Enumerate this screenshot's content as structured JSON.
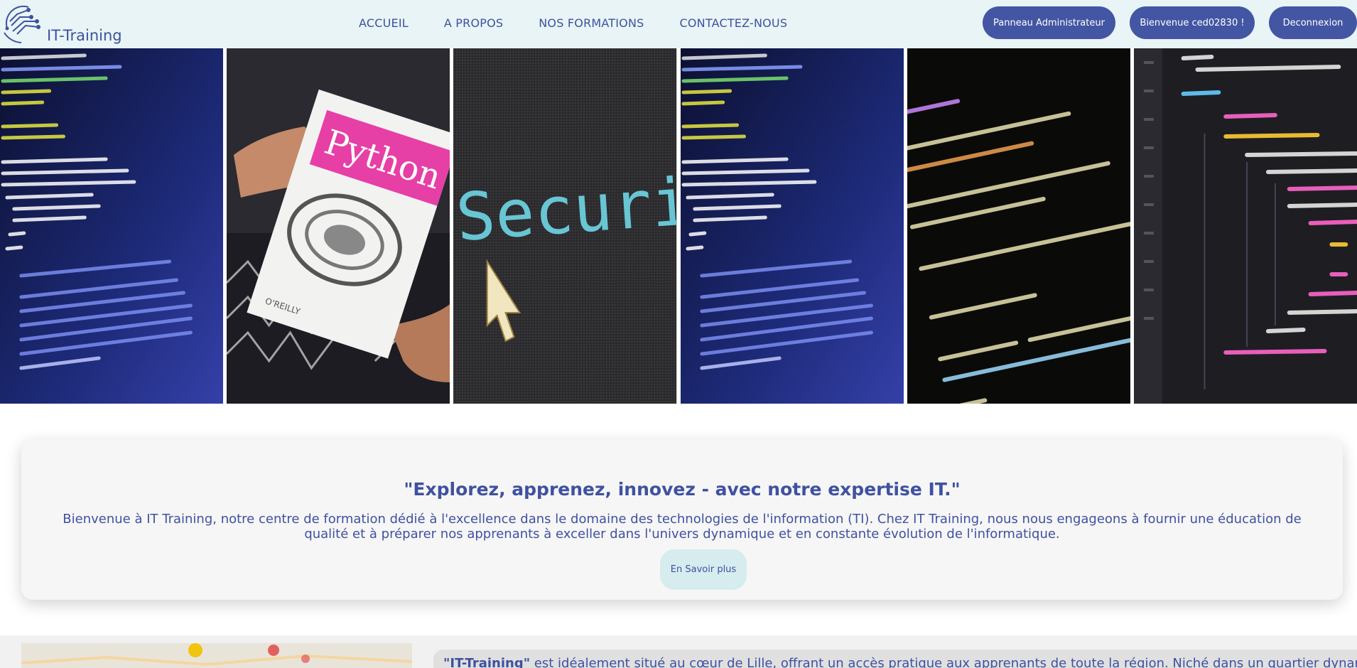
{
  "brand": {
    "name": "IT-Training"
  },
  "nav": {
    "links": [
      "ACCUEIL",
      "A PROPOS",
      "NOS FORMATIONS",
      "CONTACTEZ-NOUS"
    ]
  },
  "actions": {
    "admin_label": "Panneau Administrateur",
    "welcome_label": "Bienvenue ced02830 !",
    "logout_label": "Deconnexion"
  },
  "hero": {
    "slogan": "\"Explorez, apprenez, innovez - avec notre expertise IT.\"",
    "text": "Bienvenue à IT Training, notre centre de formation dédié à l'excellence dans le domaine des technologies de l'information (TI). Chez IT Training, nous nous engageons à fournir une éducation de qualité et à préparer nos apprenants à exceller dans l'univers dynamique et en constante évolution de l'informatique.",
    "button_label": "En Savoir plus"
  },
  "about": {
    "brand_quote": "\"IT-Training\"",
    "text": " est idéalement situé au cœur de Lille, offrant un accès pratique aux apprenants de toute la région. Niché dans un quartier dynamique et"
  },
  "colors": {
    "accent": "#3f51a0",
    "button": "#4356a3",
    "navbar_bg": "#e8f4f6",
    "hero_bg": "#f6f6f6",
    "hero_button_bg": "#d6ecef"
  },
  "tiles": [
    {
      "icon": "code-screen-image"
    },
    {
      "icon": "python-book-image"
    },
    {
      "icon": "security-screen-image"
    },
    {
      "icon": "code-screen-image"
    },
    {
      "icon": "php-code-image"
    },
    {
      "icon": "react-code-image"
    }
  ]
}
